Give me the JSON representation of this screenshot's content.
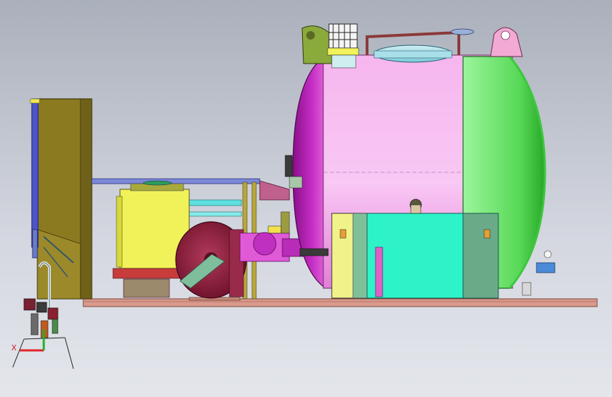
{
  "viewport": {
    "background_top": "#aab0bb",
    "background_bottom": "#e4e6ec"
  },
  "triad": {
    "x_label": "X",
    "x_color": "#e0242c",
    "y_color": "#22b02a"
  },
  "colors": {
    "tank_body": "#f49ce8",
    "tank_left_cap": "#b81eb8",
    "tank_right_cap": "#7ce97c",
    "tank_right_edge": "#3cc73c",
    "manway_lid": "#a9dfe9",
    "skid": "#d89a8c",
    "cabinet": "#8b7a1f",
    "engine_block": "#f1f25a",
    "pump_wheel": "#8f1e3c",
    "pump_arm": "#7fbe9d",
    "control_box": "#2ef2c8",
    "cyan_panel": "#3cdcd8",
    "blue_pipe": "#4b55c8",
    "olive_bracket": "#8aaa3c",
    "pink_lug": "#f2a9d4"
  }
}
